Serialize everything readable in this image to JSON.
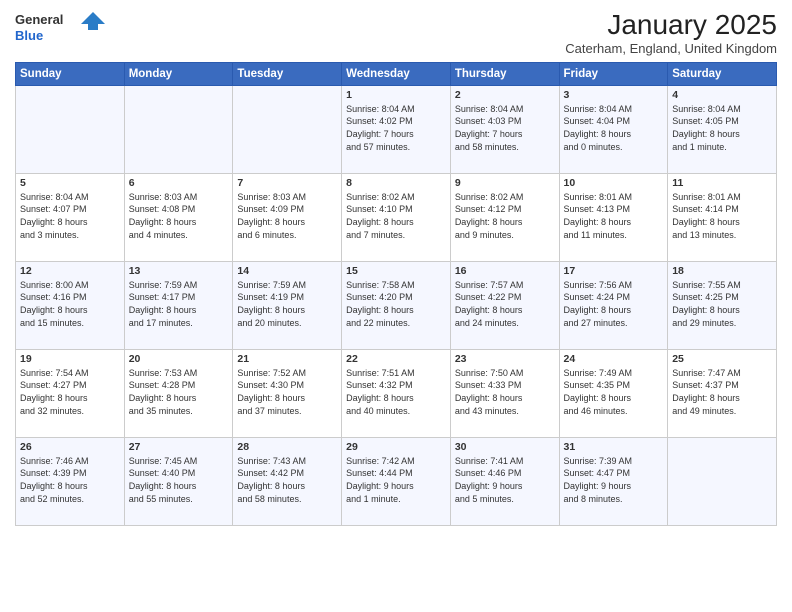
{
  "header": {
    "logo_general": "General",
    "logo_blue": "Blue",
    "month_title": "January 2025",
    "location": "Caterham, England, United Kingdom"
  },
  "days_of_week": [
    "Sunday",
    "Monday",
    "Tuesday",
    "Wednesday",
    "Thursday",
    "Friday",
    "Saturday"
  ],
  "weeks": [
    [
      {
        "day": "",
        "info": ""
      },
      {
        "day": "",
        "info": ""
      },
      {
        "day": "",
        "info": ""
      },
      {
        "day": "1",
        "info": "Sunrise: 8:04 AM\nSunset: 4:02 PM\nDaylight: 7 hours\nand 57 minutes."
      },
      {
        "day": "2",
        "info": "Sunrise: 8:04 AM\nSunset: 4:03 PM\nDaylight: 7 hours\nand 58 minutes."
      },
      {
        "day": "3",
        "info": "Sunrise: 8:04 AM\nSunset: 4:04 PM\nDaylight: 8 hours\nand 0 minutes."
      },
      {
        "day": "4",
        "info": "Sunrise: 8:04 AM\nSunset: 4:05 PM\nDaylight: 8 hours\nand 1 minute."
      }
    ],
    [
      {
        "day": "5",
        "info": "Sunrise: 8:04 AM\nSunset: 4:07 PM\nDaylight: 8 hours\nand 3 minutes."
      },
      {
        "day": "6",
        "info": "Sunrise: 8:03 AM\nSunset: 4:08 PM\nDaylight: 8 hours\nand 4 minutes."
      },
      {
        "day": "7",
        "info": "Sunrise: 8:03 AM\nSunset: 4:09 PM\nDaylight: 8 hours\nand 6 minutes."
      },
      {
        "day": "8",
        "info": "Sunrise: 8:02 AM\nSunset: 4:10 PM\nDaylight: 8 hours\nand 7 minutes."
      },
      {
        "day": "9",
        "info": "Sunrise: 8:02 AM\nSunset: 4:12 PM\nDaylight: 8 hours\nand 9 minutes."
      },
      {
        "day": "10",
        "info": "Sunrise: 8:01 AM\nSunset: 4:13 PM\nDaylight: 8 hours\nand 11 minutes."
      },
      {
        "day": "11",
        "info": "Sunrise: 8:01 AM\nSunset: 4:14 PM\nDaylight: 8 hours\nand 13 minutes."
      }
    ],
    [
      {
        "day": "12",
        "info": "Sunrise: 8:00 AM\nSunset: 4:16 PM\nDaylight: 8 hours\nand 15 minutes."
      },
      {
        "day": "13",
        "info": "Sunrise: 7:59 AM\nSunset: 4:17 PM\nDaylight: 8 hours\nand 17 minutes."
      },
      {
        "day": "14",
        "info": "Sunrise: 7:59 AM\nSunset: 4:19 PM\nDaylight: 8 hours\nand 20 minutes."
      },
      {
        "day": "15",
        "info": "Sunrise: 7:58 AM\nSunset: 4:20 PM\nDaylight: 8 hours\nand 22 minutes."
      },
      {
        "day": "16",
        "info": "Sunrise: 7:57 AM\nSunset: 4:22 PM\nDaylight: 8 hours\nand 24 minutes."
      },
      {
        "day": "17",
        "info": "Sunrise: 7:56 AM\nSunset: 4:24 PM\nDaylight: 8 hours\nand 27 minutes."
      },
      {
        "day": "18",
        "info": "Sunrise: 7:55 AM\nSunset: 4:25 PM\nDaylight: 8 hours\nand 29 minutes."
      }
    ],
    [
      {
        "day": "19",
        "info": "Sunrise: 7:54 AM\nSunset: 4:27 PM\nDaylight: 8 hours\nand 32 minutes."
      },
      {
        "day": "20",
        "info": "Sunrise: 7:53 AM\nSunset: 4:28 PM\nDaylight: 8 hours\nand 35 minutes."
      },
      {
        "day": "21",
        "info": "Sunrise: 7:52 AM\nSunset: 4:30 PM\nDaylight: 8 hours\nand 37 minutes."
      },
      {
        "day": "22",
        "info": "Sunrise: 7:51 AM\nSunset: 4:32 PM\nDaylight: 8 hours\nand 40 minutes."
      },
      {
        "day": "23",
        "info": "Sunrise: 7:50 AM\nSunset: 4:33 PM\nDaylight: 8 hours\nand 43 minutes."
      },
      {
        "day": "24",
        "info": "Sunrise: 7:49 AM\nSunset: 4:35 PM\nDaylight: 8 hours\nand 46 minutes."
      },
      {
        "day": "25",
        "info": "Sunrise: 7:47 AM\nSunset: 4:37 PM\nDaylight: 8 hours\nand 49 minutes."
      }
    ],
    [
      {
        "day": "26",
        "info": "Sunrise: 7:46 AM\nSunset: 4:39 PM\nDaylight: 8 hours\nand 52 minutes."
      },
      {
        "day": "27",
        "info": "Sunrise: 7:45 AM\nSunset: 4:40 PM\nDaylight: 8 hours\nand 55 minutes."
      },
      {
        "day": "28",
        "info": "Sunrise: 7:43 AM\nSunset: 4:42 PM\nDaylight: 8 hours\nand 58 minutes."
      },
      {
        "day": "29",
        "info": "Sunrise: 7:42 AM\nSunset: 4:44 PM\nDaylight: 9 hours\nand 1 minute."
      },
      {
        "day": "30",
        "info": "Sunrise: 7:41 AM\nSunset: 4:46 PM\nDaylight: 9 hours\nand 5 minutes."
      },
      {
        "day": "31",
        "info": "Sunrise: 7:39 AM\nSunset: 4:47 PM\nDaylight: 9 hours\nand 8 minutes."
      },
      {
        "day": "",
        "info": ""
      }
    ]
  ]
}
